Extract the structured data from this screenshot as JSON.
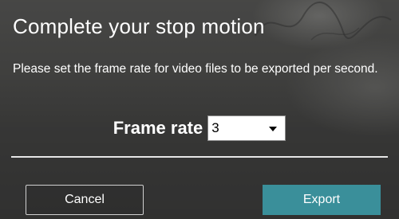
{
  "dialog": {
    "title": "Complete your stop motion",
    "description": "Please set the frame rate for video files to be exported per second.",
    "frame_rate": {
      "label": "Frame rate",
      "selected": "3"
    },
    "buttons": {
      "cancel": "Cancel",
      "export": "Export"
    }
  },
  "colors": {
    "export_button": "#3a8f9a",
    "text": "#ffffff"
  }
}
